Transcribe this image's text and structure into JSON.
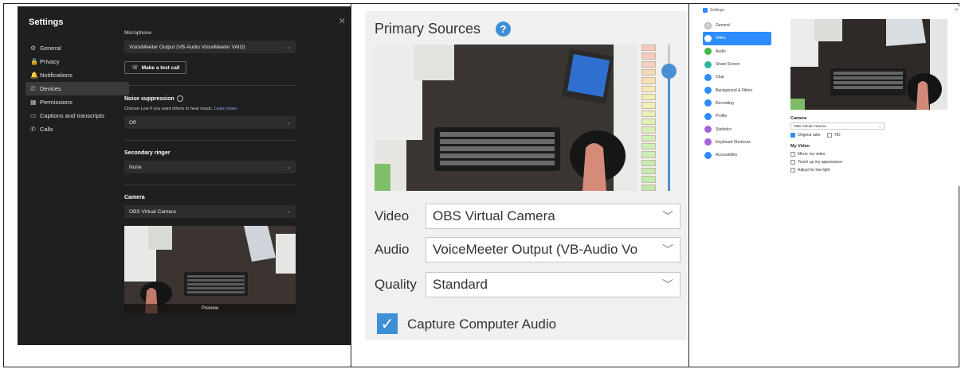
{
  "teams": {
    "title": "Settings",
    "close_icon": "close-icon",
    "nav": [
      {
        "label": "General",
        "icon": "gear-icon",
        "glyph": "⚙"
      },
      {
        "label": "Privacy",
        "icon": "lock-icon",
        "glyph": "🔒"
      },
      {
        "label": "Notifications",
        "icon": "bell-icon",
        "glyph": "🔔"
      },
      {
        "label": "Devices",
        "icon": "devices-icon",
        "glyph": "⎚"
      },
      {
        "label": "Permissions",
        "icon": "grid-icon",
        "glyph": "▦"
      },
      {
        "label": "Captions and transcripts",
        "icon": "cc-icon",
        "glyph": "▭"
      },
      {
        "label": "Calls",
        "icon": "phone-icon",
        "glyph": "✆"
      }
    ],
    "microphone_label": "Microphone",
    "microphone_value": "VoiceMeeter Output (VB-Audio VoiceMeeter VAIO)",
    "test_call_label": "Make a test call",
    "noise_label": "Noise suppression",
    "noise_help": "Choose Low if you want others to hear music.",
    "noise_help_link": "Learn more.",
    "noise_value": "Off",
    "ringer_label": "Secondary ringer",
    "ringer_value": "None",
    "camera_label": "Camera",
    "camera_value": "OBS Virtual Camera",
    "preview_label": "Preview"
  },
  "obs": {
    "title": "Primary Sources",
    "video_label": "Video",
    "video_value": "OBS Virtual Camera",
    "audio_label": "Audio",
    "audio_value": "VoiceMeeter Output (VB-Audio Vo",
    "quality_label": "Quality",
    "quality_value": "Standard",
    "capture_label": "Capture Computer Audio",
    "capture_checked": true,
    "accent": "#3d8fd6"
  },
  "zoom": {
    "title": "Settings",
    "nav": [
      {
        "label": "General",
        "color": "#cfcfcf"
      },
      {
        "label": "Video",
        "color": "#ffffff"
      },
      {
        "label": "Audio",
        "color": "#43b649"
      },
      {
        "label": "Share Screen",
        "color": "#2fb89b"
      },
      {
        "label": "Chat",
        "color": "#2d8cff"
      },
      {
        "label": "Background & Filters",
        "color": "#2d8cff"
      },
      {
        "label": "Recording",
        "color": "#2d8cff"
      },
      {
        "label": "Profile",
        "color": "#2d8cff"
      },
      {
        "label": "Statistics",
        "color": "#a463d8"
      },
      {
        "label": "Keyboard Shortcuts",
        "color": "#a463d8"
      },
      {
        "label": "Accessibility",
        "color": "#2d8cff"
      }
    ],
    "camera_label": "Camera",
    "camera_value": "OBS Virtual Camera",
    "original_ratio": "Original ratio",
    "hd": "HD",
    "my_video_label": "My Video",
    "mirror": "Mirror my video",
    "touch_up": "Touch up my appearance",
    "low_light": "Adjust for low light",
    "accent": "#2d8cff"
  }
}
